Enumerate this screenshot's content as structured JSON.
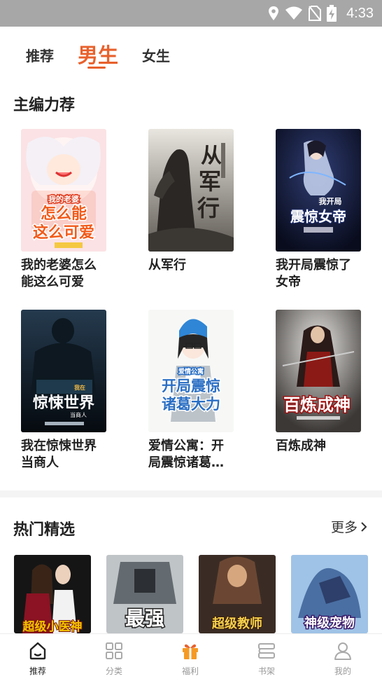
{
  "status_bar": {
    "time": "4:33"
  },
  "top_tabs": [
    {
      "label": "推荐",
      "active": false
    },
    {
      "label": "男生",
      "active": true
    },
    {
      "label": "女生",
      "active": false
    }
  ],
  "editor_picks": {
    "title": "主编力荐",
    "books": [
      {
        "title": "我的老婆怎么能这么可爱",
        "cover_text": [
          "我的老婆",
          "怎么能",
          "这么可爱"
        ]
      },
      {
        "title": "从军行",
        "cover_text": [
          "从",
          "军",
          "行"
        ]
      },
      {
        "title": "我开局震惊了女帝",
        "cover_text": [
          "我开局",
          "震惊女帝"
        ]
      },
      {
        "title": "我在惊悚世界当商人",
        "cover_text": [
          "我在",
          "惊悚世界",
          "当商人"
        ]
      },
      {
        "title": "爱情公寓：开局震惊诸葛大力",
        "cover_text": [
          "爱情公寓",
          "开局震惊",
          "诸葛大力"
        ]
      },
      {
        "title": "百炼成神",
        "cover_text": [
          "百炼成神"
        ]
      }
    ]
  },
  "hot_picks": {
    "title": "热门精选",
    "more_label": "更多",
    "books": [
      {
        "cover_text": "超级小医神"
      },
      {
        "cover_text": "最强"
      },
      {
        "cover_text": "超级教师"
      },
      {
        "cover_text": "神级宠物"
      }
    ]
  },
  "bottom_nav": [
    {
      "label": "推荐",
      "icon": "home-icon",
      "active": true
    },
    {
      "label": "分类",
      "icon": "grid-icon",
      "active": false
    },
    {
      "label": "福利",
      "icon": "gift-icon",
      "active": false
    },
    {
      "label": "书架",
      "icon": "bookshelf-icon",
      "active": false
    },
    {
      "label": "我的",
      "icon": "user-icon",
      "active": false
    }
  ],
  "colors": {
    "accent": "#e8612c",
    "status_bar": "#a7a7a7",
    "gift": "#f59a23"
  }
}
